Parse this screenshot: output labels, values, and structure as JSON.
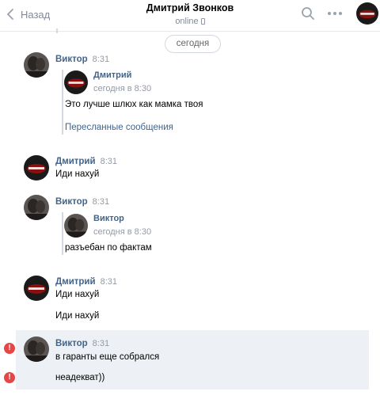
{
  "header": {
    "back_label": "Назад",
    "title": "Дмитрий Звонков",
    "status": "online"
  },
  "date_divider": "сегодня",
  "messages": [
    {
      "author": "Виктор",
      "time": "8:31",
      "forwarded": {
        "author": "Дмитрий",
        "time": "сегодня в 8:30",
        "text": "Это лучше шлюх как мамка твоя",
        "link": "Пересланные сообщения"
      }
    },
    {
      "author": "Дмитрий",
      "time": "8:31",
      "text": "Иди нахуй"
    },
    {
      "author": "Виктор",
      "time": "8:31",
      "forwarded": {
        "author": "Виктор",
        "time": "сегодня в 8:30",
        "text": "разъебан по фактам"
      }
    },
    {
      "author": "Дмитрий",
      "time": "8:31",
      "text": "Иди нахуй",
      "text2": "Иди нахуй"
    },
    {
      "author": "Виктор",
      "time": "8:31",
      "text": "в гаранты еще собрался",
      "text2": "неадекват))",
      "error_mark": "!"
    }
  ],
  "colors": {
    "link": "#42648b",
    "muted": "#939aa5",
    "selected": "#edf0f5",
    "error": "#e64646"
  },
  "icons": [
    "back-chevron-icon",
    "search-icon",
    "more-dots-icon",
    "phone-icon",
    "error-icon"
  ]
}
